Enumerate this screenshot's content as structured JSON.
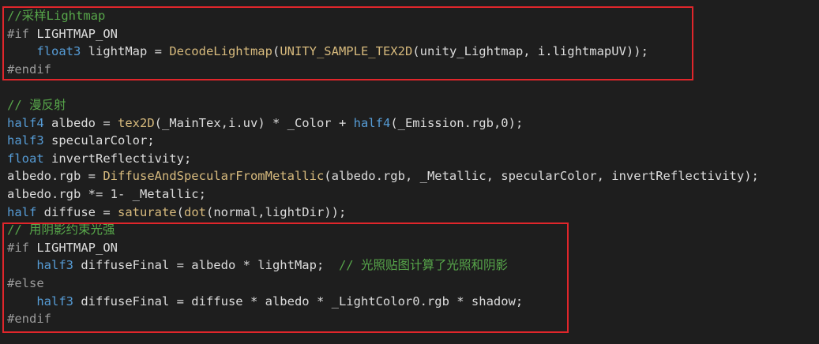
{
  "editor": {
    "colors": {
      "background": "#1e1e1e",
      "comment": "#57a64a",
      "preprocessor": "#9b9b9b",
      "keyword": "#569cd6",
      "function": "#d7ba7d",
      "identifier": "#dcdcdc",
      "highlight_box": "#e0262b"
    },
    "lines": [
      [
        {
          "text": "//采样Lightmap",
          "type": "comment"
        }
      ],
      [
        {
          "text": "#if",
          "type": "pre"
        },
        {
          "text": " LIGHTMAP_ON",
          "type": "id"
        }
      ],
      [
        {
          "text": "    ",
          "type": "id"
        },
        {
          "text": "float3",
          "type": "kw"
        },
        {
          "text": " lightMap = ",
          "type": "id"
        },
        {
          "text": "DecodeLightmap",
          "type": "fn"
        },
        {
          "text": "(",
          "type": "id"
        },
        {
          "text": "UNITY_SAMPLE_TEX2D",
          "type": "fn"
        },
        {
          "text": "(unity_Lightmap, i.lightmapUV));",
          "type": "id"
        }
      ],
      [
        {
          "text": "#endif",
          "type": "pre"
        }
      ],
      [],
      [
        {
          "text": "// 漫反射",
          "type": "comment"
        }
      ],
      [
        {
          "text": "half4",
          "type": "kw"
        },
        {
          "text": " albedo = ",
          "type": "id"
        },
        {
          "text": "tex2D",
          "type": "fn"
        },
        {
          "text": "(_MainTex,i.uv) * _Color + ",
          "type": "id"
        },
        {
          "text": "half4",
          "type": "kw"
        },
        {
          "text": "(_Emission.rgb,0);",
          "type": "id"
        }
      ],
      [
        {
          "text": "half3",
          "type": "kw"
        },
        {
          "text": " specularColor;",
          "type": "id"
        }
      ],
      [
        {
          "text": "float",
          "type": "kw"
        },
        {
          "text": " invertReflectivity;",
          "type": "id"
        }
      ],
      [
        {
          "text": "albedo.rgb = ",
          "type": "id"
        },
        {
          "text": "DiffuseAndSpecularFromMetallic",
          "type": "fn"
        },
        {
          "text": "(albedo.rgb, _Metallic, specularColor, invertReflectivity);",
          "type": "id"
        }
      ],
      [
        {
          "text": "albedo.rgb *= 1- _Metallic;",
          "type": "id"
        }
      ],
      [
        {
          "text": "half",
          "type": "kw"
        },
        {
          "text": " diffuse = ",
          "type": "id"
        },
        {
          "text": "saturate",
          "type": "fn"
        },
        {
          "text": "(",
          "type": "id"
        },
        {
          "text": "dot",
          "type": "fn"
        },
        {
          "text": "(normal,lightDir));",
          "type": "id"
        }
      ],
      [
        {
          "text": "// 用阴影约束光强",
          "type": "comment"
        }
      ],
      [
        {
          "text": "#if",
          "type": "pre"
        },
        {
          "text": " LIGHTMAP_ON",
          "type": "id"
        }
      ],
      [
        {
          "text": "    ",
          "type": "id"
        },
        {
          "text": "half3",
          "type": "kw"
        },
        {
          "text": " diffuseFinal = albedo * lightMap;  ",
          "type": "id"
        },
        {
          "text": "// 光照贴图计算了光照和阴影",
          "type": "comment"
        }
      ],
      [
        {
          "text": "#else",
          "type": "pre"
        }
      ],
      [
        {
          "text": "    ",
          "type": "id"
        },
        {
          "text": "half3",
          "type": "kw"
        },
        {
          "text": " diffuseFinal = diffuse * albedo * _LightColor0.rgb * shadow;",
          "type": "id"
        }
      ],
      [
        {
          "text": "#endif",
          "type": "pre"
        }
      ]
    ]
  }
}
